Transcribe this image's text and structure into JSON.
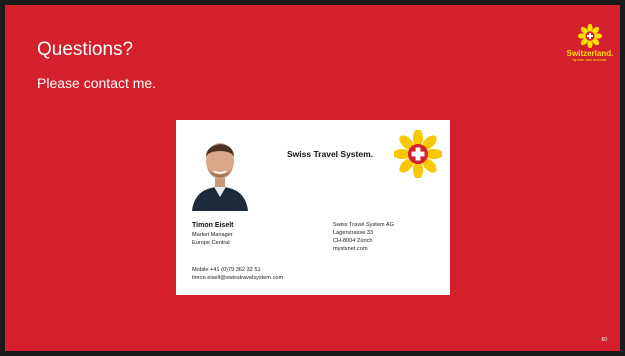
{
  "slide": {
    "title": "Questions?",
    "subtitle": "Please contact me.",
    "page_number": "60",
    "background_color": "#d3202c"
  },
  "brand": {
    "name": "Switzerland.",
    "tagline": "by train, bus and boat.",
    "icon": "alpine-flower-icon"
  },
  "card": {
    "company_mark": "Swiss Travel System.",
    "logo_icon": "swiss-cross-flower-icon",
    "name": "Timon Eiselt",
    "role_lines": [
      "Market Manager",
      "Europe Central"
    ],
    "company_lines": [
      "Swiss Travel System AG",
      "Lagerstrasse 33",
      "CH-8004 Zürich",
      "mystsnet.com"
    ],
    "contact_lines": [
      "Mobile +41 (0)79 362 32 51",
      "timon.eiselt@swisstravelsystem.com"
    ]
  }
}
